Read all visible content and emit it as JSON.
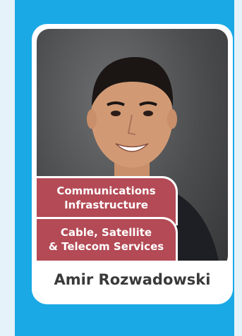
{
  "profile_card": {
    "name": "Amir Rozwadowski",
    "tags": [
      {
        "line1": "Communications",
        "line2": "Infrastructure"
      },
      {
        "line1": "Cable, Satellite",
        "line2": "& Telecom Services"
      }
    ],
    "photo_icon": "person-portrait"
  },
  "colors": {
    "page_background": "#e6f2fa",
    "panel_blue": "#1ba9e6",
    "tag_red": "#b34a55",
    "name_text": "#3a3a3a"
  }
}
